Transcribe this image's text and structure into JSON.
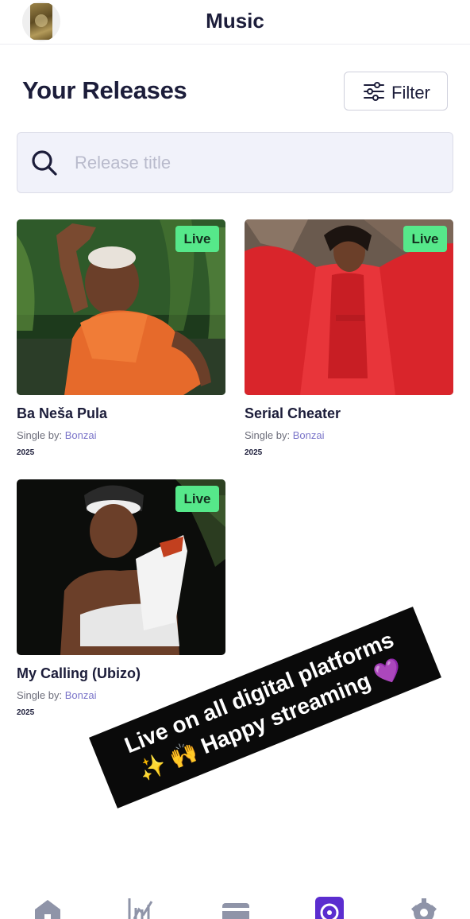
{
  "header": {
    "title": "Music",
    "avatar_icon": "label-logo-icon"
  },
  "section": {
    "title": "Your Releases",
    "filter_label": "Filter",
    "filter_icon": "sliders-icon"
  },
  "search": {
    "placeholder": "Release title",
    "value": "",
    "icon": "search-icon"
  },
  "releases": [
    {
      "title": "Ba Neša Pula",
      "type_prefix": "Single by: ",
      "artist": "Bonzai",
      "year": "2025",
      "status": "Live"
    },
    {
      "title": "Serial Cheater",
      "type_prefix": "Single by: ",
      "artist": "Bonzai",
      "year": "2025",
      "status": "Live"
    },
    {
      "title": "My Calling (Ubizo)",
      "type_prefix": "Single by: ",
      "artist": "Bonzai",
      "year": "2025",
      "status": "Live"
    }
  ],
  "overlay": {
    "line1": "Live on all digital platforms",
    "line2": "✨ 🙌 Happy streaming 💜"
  },
  "bottom_nav": [
    {
      "icon": "home-icon",
      "active": false
    },
    {
      "icon": "analytics-icon",
      "active": false
    },
    {
      "icon": "wallet-icon",
      "active": false
    },
    {
      "icon": "music-icon",
      "active": true
    },
    {
      "icon": "settings-icon",
      "active": false
    }
  ],
  "colors": {
    "accent": "#5b2dcf",
    "live_badge": "#56e88a",
    "text": "#1c1d3a",
    "artist_link": "#7b75c9",
    "nav_inactive": "#8f94a8"
  }
}
